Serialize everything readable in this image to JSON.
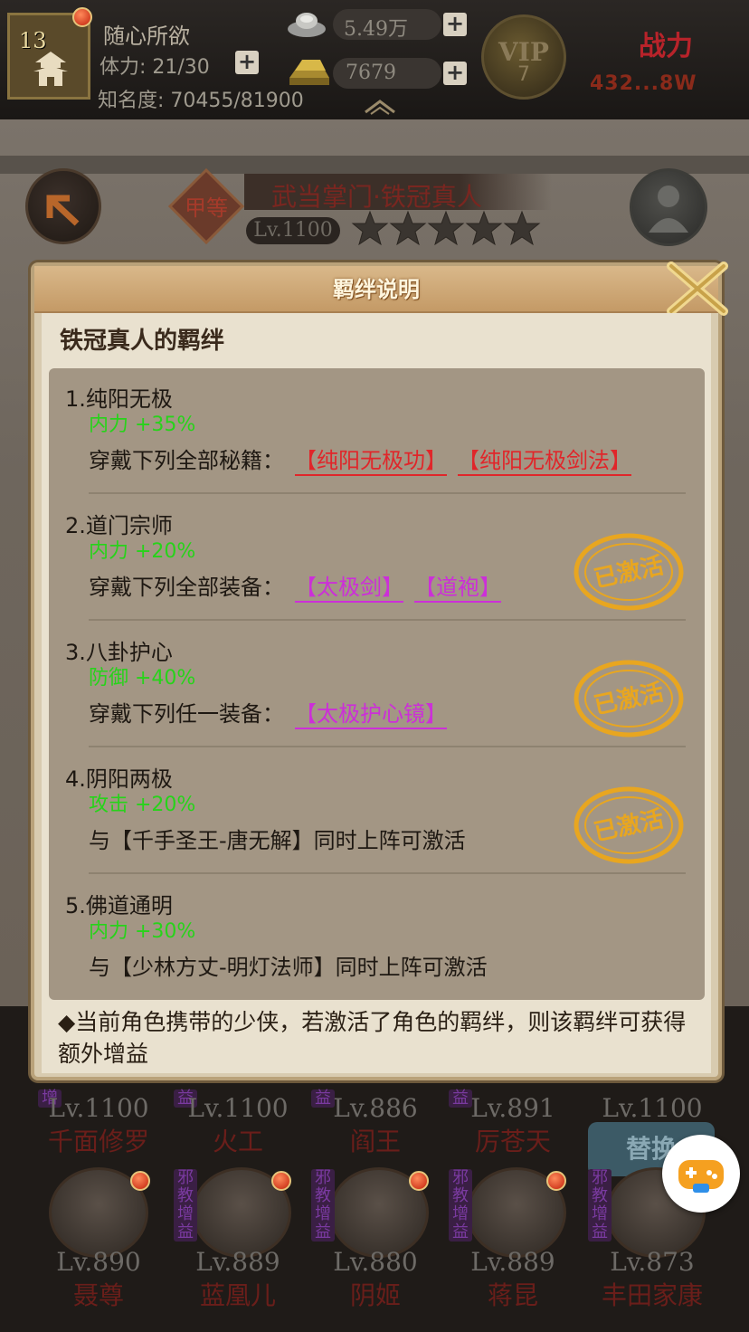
{
  "player": {
    "level": "13",
    "name": "随心所欲",
    "stamina": "体力: 21/30",
    "fame": "知名度: 70455/81900"
  },
  "currency": {
    "silver": "5.49万",
    "gold": "7679"
  },
  "vip": {
    "label": "VIP",
    "level": "7"
  },
  "power": {
    "label": "战力",
    "value": "432...8W"
  },
  "hero": {
    "rank_badge": "甲等",
    "title": "武当掌门·铁冠真人",
    "level": "Lv.1100",
    "stars": 5
  },
  "dialog": {
    "title": "羁绊说明",
    "subtitle": "铁冠真人的羁绊",
    "bonds": [
      {
        "title": "1.纯阳无极",
        "stat": "内力 +35%",
        "requirement": "穿戴下列全部秘籍：",
        "items": [
          "【纯阳无极功】",
          "【纯阳无极剑法】"
        ],
        "item_color": "red",
        "activated": false
      },
      {
        "title": "2.道门宗师",
        "stat": "内力 +20%",
        "requirement": "穿戴下列全部装备：",
        "items": [
          "【太极剑】",
          "【道袍】"
        ],
        "item_color": "purple",
        "activated": true
      },
      {
        "title": "3.八卦护心",
        "stat": "防御 +40%",
        "requirement": "穿戴下列任一装备：",
        "items": [
          "【太极护心镜】"
        ],
        "item_color": "purple",
        "activated": true
      },
      {
        "title": "4.阴阳两极",
        "stat": "攻击 +20%",
        "requirement": "与【千手圣王-唐无解】同时上阵可激活",
        "items": [],
        "item_color": "",
        "activated": true
      },
      {
        "title": "5.佛道通明",
        "stat": "内力 +30%",
        "requirement": "与【少林方丈-明灯法师】同时上阵可激活",
        "items": [],
        "item_color": "",
        "activated": false
      }
    ],
    "stamp_text": "已激活",
    "footnote": "◆当前角色携带的少侠，若激活了角色的羁绊，则该羁绊可获得额外增益"
  },
  "roster": {
    "row1": [
      {
        "level": "Lv.1100",
        "name": "千面修罗"
      },
      {
        "level": "Lv.1100",
        "name": "火工"
      },
      {
        "level": "Lv.886",
        "name": "阎王"
      },
      {
        "level": "Lv.891",
        "name": "厉苍天"
      },
      {
        "level": "Lv.1100",
        "name": ""
      }
    ],
    "row2": [
      {
        "level": "Lv.890",
        "name": "聂尊"
      },
      {
        "level": "Lv.889",
        "name": "蓝凰儿"
      },
      {
        "level": "Lv.880",
        "name": "阴姬"
      },
      {
        "level": "Lv.889",
        "name": "蒋昆"
      },
      {
        "level": "Lv.873",
        "name": "丰田家康"
      }
    ],
    "tag": "邪教增益",
    "swap_label": "替换"
  },
  "colors": {
    "stat_green": "#27d31a",
    "item_red": "#e0262a",
    "item_purple": "#cc2fd8",
    "stamp_gold": "#e8a620"
  }
}
